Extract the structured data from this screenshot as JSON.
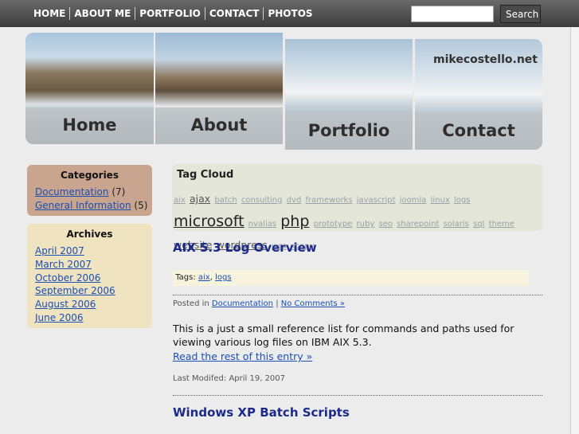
{
  "nav": {
    "items": [
      "HOME",
      "ABOUT ME",
      "PORTFOLIO",
      "CONTACT",
      "PHOTOS"
    ],
    "search_button": "Search",
    "search_value": ""
  },
  "header": {
    "tiles": [
      "Home",
      "About",
      "Portfolio",
      "Contact"
    ],
    "site_name": "mikecostello.net"
  },
  "sidebar": {
    "categories": {
      "title": "Categories",
      "items": [
        {
          "label": "Documentation",
          "count": "(7)"
        },
        {
          "label": "General Information",
          "count": "(5)"
        }
      ]
    },
    "archives": {
      "title": "Archives",
      "items": [
        "April 2007",
        "March 2007",
        "October 2006",
        "September 2006",
        "August 2006",
        "June 2006"
      ]
    }
  },
  "tag_cloud": {
    "title": "Tag Cloud",
    "tags": [
      {
        "label": "aix",
        "size": "small"
      },
      {
        "label": "ajax",
        "size": "medium"
      },
      {
        "label": "batch",
        "size": "small"
      },
      {
        "label": "consulting",
        "size": "small"
      },
      {
        "label": "dvd",
        "size": "small"
      },
      {
        "label": "frameworks",
        "size": "small"
      },
      {
        "label": "javascript",
        "size": "small"
      },
      {
        "label": "joomla",
        "size": "small"
      },
      {
        "label": "linux",
        "size": "small"
      },
      {
        "label": "logs",
        "size": "small"
      },
      {
        "label": "microsoft",
        "size": "large"
      },
      {
        "label": "nvalias",
        "size": "small"
      },
      {
        "label": "php",
        "size": "large"
      },
      {
        "label": "prototype",
        "size": "small"
      },
      {
        "label": "ruby",
        "size": "small"
      },
      {
        "label": "seo",
        "size": "small"
      },
      {
        "label": "sharepoint",
        "size": "small"
      },
      {
        "label": "solaris",
        "size": "small"
      },
      {
        "label": "sql",
        "size": "small"
      },
      {
        "label": "theme",
        "size": "small"
      },
      {
        "label": "website",
        "size": "medium"
      },
      {
        "label": "wordpress",
        "size": "medium"
      },
      {
        "label": "wss",
        "size": "small"
      },
      {
        "label": "xcopy",
        "size": "small"
      }
    ]
  },
  "posts": [
    {
      "title": "AIX 5.3 Log Overview",
      "tags_label": "Tags:",
      "tags": [
        "aix",
        "logs"
      ],
      "posted_in_label": "Posted in",
      "category": "Documentation",
      "separator": "|",
      "comments": "No Comments »",
      "body": "This is a just a small reference list for commands and paths used for viewing various log files on IBM AIX 5.3.",
      "read_more": "Read the rest of this entry »",
      "last_modified": "Last Modifed: April 19, 2007"
    },
    {
      "title": "Windows XP Batch Scripts"
    }
  ],
  "colors": {
    "post_title": "#1c2a8c",
    "link": "#1a4fb3",
    "categories_bg": "#c9a48e",
    "archives_bg": "#f0e3c0",
    "tagcloud_bg": "#e4e6d9"
  }
}
